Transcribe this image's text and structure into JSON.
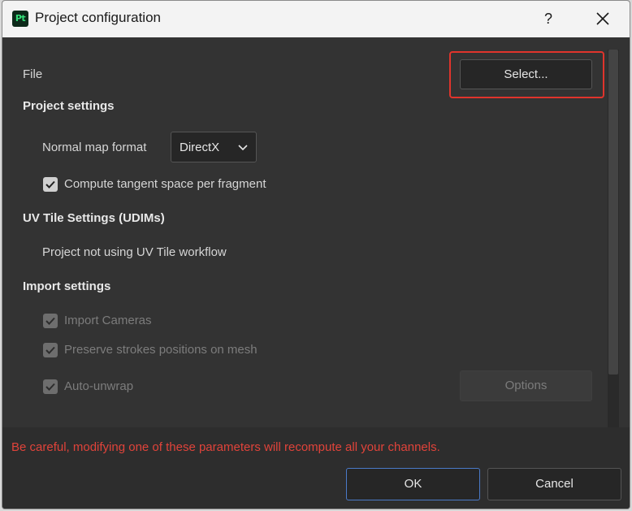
{
  "window": {
    "app_icon_text": "Pt",
    "title": "Project configuration",
    "help_label": "?"
  },
  "file": {
    "label": "File",
    "select_label": "Select..."
  },
  "project_settings": {
    "header": "Project settings",
    "normal_map_label": "Normal map format",
    "normal_map_value": "DirectX",
    "tangent_label": "Compute tangent space per fragment",
    "tangent_checked": true
  },
  "uv_tile": {
    "header": "UV Tile Settings (UDIMs)",
    "status": "Project not using UV Tile workflow"
  },
  "import_settings": {
    "header": "Import settings",
    "import_cameras_label": "Import Cameras",
    "preserve_strokes_label": "Preserve strokes positions on mesh",
    "auto_unwrap_label": "Auto-unwrap",
    "options_label": "Options"
  },
  "footer": {
    "warning": "Be careful, modifying one of these parameters will recompute all your channels.",
    "ok_label": "OK",
    "cancel_label": "Cancel"
  },
  "colors": {
    "accent": "#4a7ac8",
    "warning": "#e0433a",
    "highlight": "#e0342c"
  }
}
